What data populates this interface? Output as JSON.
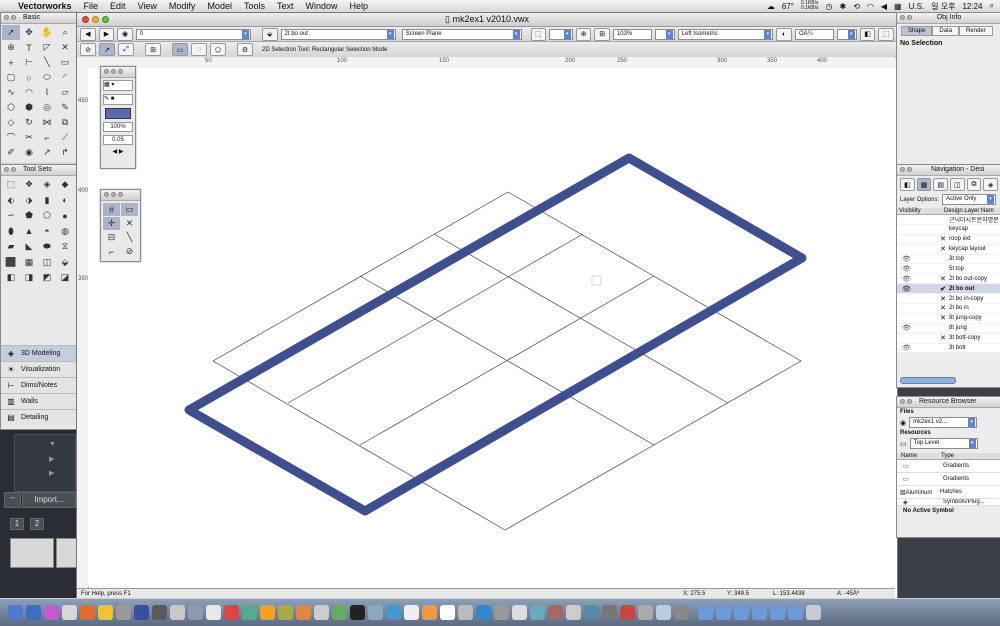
{
  "menubar": {
    "app": "Vectorworks",
    "items": [
      "File",
      "Edit",
      "View",
      "Modify",
      "Model",
      "Tools",
      "Text",
      "Window",
      "Help"
    ],
    "temp": "67°",
    "net_up": "0.1KB/s",
    "net_down": "0.1KB/s",
    "locale": "U.S.",
    "clock_day": "일 오후",
    "clock_time": "12:24"
  },
  "basic_palette": {
    "title": "Basic"
  },
  "toolsets_palette": {
    "title": "Tool Sets",
    "sets": [
      "3D Modeling",
      "Visualization",
      "Dims/Notes",
      "Walls",
      "Detailing"
    ]
  },
  "attributes_palette": {
    "zoom": "100%",
    "line_weight": "0.05"
  },
  "background_app": {
    "import_label": "Import...",
    "page1": "1",
    "page2": "2"
  },
  "window": {
    "title": "mk2ex1 v2010.vwx",
    "class_value": "0",
    "layer_value": "2t bo out",
    "plane_value": "Screen Plane",
    "zoom_value": "103%",
    "view_value": "Left Isometric",
    "render_value": "OÀ¼",
    "mode_hint": "2D Selection Tool: Rectangular Selection Mode"
  },
  "ruler": {
    "top_labels": [
      "50",
      "100",
      "150",
      "200",
      "250",
      "300",
      "350",
      "400"
    ],
    "left_labels": [
      "450",
      "400",
      "350"
    ]
  },
  "status": {
    "help": "For Help, press F1",
    "x": "X:  275.5",
    "y": "Y:  349.5",
    "l": "L:  153.4438",
    "a": "A:  -45Àº"
  },
  "obj_info": {
    "title": "Obj Info",
    "tabs": [
      "Shape",
      "Data",
      "Render"
    ],
    "selection": "No Selection"
  },
  "navigation": {
    "title": "Navigation - Desi",
    "layer_options_label": "Layer Options:",
    "layer_options_value": "Active Only",
    "col_visibility": "Visibility",
    "col_name": "Design Layer Nam",
    "layers": [
      {
        "name": "근닉더시트문자명분",
        "vis": "",
        "active": ""
      },
      {
        "name": "keycap",
        "vis": "",
        "active": ""
      },
      {
        "name": "roop ext",
        "vis": "",
        "active": "✕"
      },
      {
        "name": "keycap layout",
        "vis": "",
        "active": "✕"
      },
      {
        "name": "3t top",
        "vis": "👁",
        "active": ""
      },
      {
        "name": "5t top",
        "vis": "👁",
        "active": ""
      },
      {
        "name": "2t bo out-copy",
        "vis": "👁",
        "active": "✕"
      },
      {
        "name": "2t bo out",
        "vis": "👁",
        "active": "✔"
      },
      {
        "name": "2t bo in-copy",
        "vis": "",
        "active": "✕"
      },
      {
        "name": "2t bo in",
        "vis": "",
        "active": "✕"
      },
      {
        "name": "8t jung-copy",
        "vis": "",
        "active": "✕"
      },
      {
        "name": "8t jung",
        "vis": "👁",
        "active": ""
      },
      {
        "name": "3t bott-copy",
        "vis": "",
        "active": "✕"
      },
      {
        "name": "3t bott",
        "vis": "👁",
        "active": ""
      }
    ]
  },
  "resources": {
    "title": "Resource Browser",
    "files_label": "Files",
    "file_value": "mk2ex1 v2...",
    "resources_label": "Resources",
    "level_value": "Top Level",
    "col_name": "Name",
    "col_type": "Type",
    "rows": [
      {
        "name": "",
        "type": "Gradients"
      },
      {
        "name": "",
        "type": "Gradients"
      },
      {
        "name": "Aluminum",
        "type": "Hatches"
      },
      {
        "name": "",
        "type": "Symbols/Plug..."
      }
    ],
    "footer": "No Active Symbol"
  },
  "colors": {
    "plate": "#3d4f8e",
    "plate_edge": "#26346a",
    "accent_blue": "#5a84d8"
  }
}
